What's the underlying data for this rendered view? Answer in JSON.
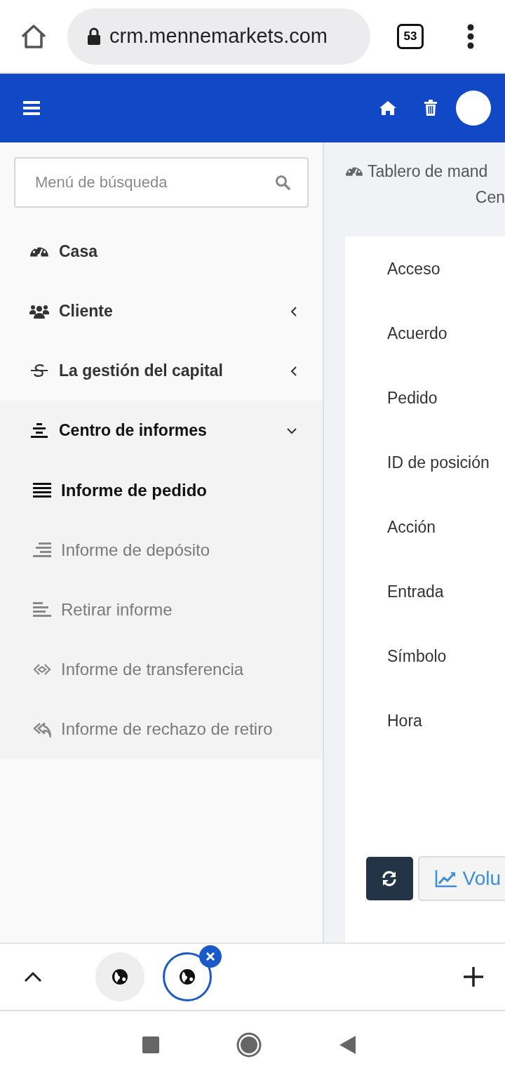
{
  "browser": {
    "url": "crm.mennemarkets.com",
    "tab_count": "53"
  },
  "sidebar": {
    "search": {
      "placeholder": "Menú de búsqueda"
    },
    "items": [
      {
        "label": "Casa"
      },
      {
        "label": "Cliente",
        "expanded": false
      },
      {
        "label": "La gestión del capital",
        "expanded": false
      },
      {
        "label": "Centro de informes",
        "expanded": true,
        "children": [
          {
            "label": "Informe de pedido",
            "selected": true
          },
          {
            "label": "Informe de depósito",
            "selected": false
          },
          {
            "label": "Retirar informe",
            "selected": false
          },
          {
            "label": "Informe de transferencia",
            "selected": false
          },
          {
            "label": "Informe de rechazo de retiro",
            "selected": false
          }
        ]
      }
    ]
  },
  "breadcrumb": [
    "Tablero de mand",
    "Cen"
  ],
  "detail_fields": [
    "Acceso",
    "Acuerdo",
    "Pedido",
    "ID de posición",
    "Acción",
    "Entrada",
    "Símbolo",
    "Hora"
  ],
  "buttons": [
    {
      "kind": "refresh"
    },
    {
      "kind": "chart",
      "label": "Volu"
    }
  ],
  "tab_strip": {
    "tabs": [
      {
        "selected": false
      },
      {
        "selected": true
      }
    ]
  }
}
